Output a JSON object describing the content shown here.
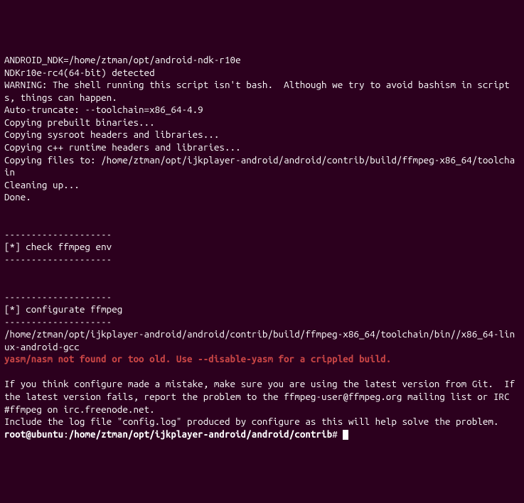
{
  "terminal": {
    "lines": [
      "ANDROID_NDK=/home/ztman/opt/android-ndk-r10e",
      "NDKr10e-rc4(64-bit) detected",
      "WARNING: The shell running this script isn't bash.  Although we try to avoid bashism in scripts, things can happen.",
      "Auto-truncate: --toolchain=x86_64-4.9",
      "Copying prebuilt binaries...",
      "Copying sysroot headers and libraries...",
      "Copying c++ runtime headers and libraries...",
      "Copying files to: /home/ztman/opt/ijkplayer-android/android/contrib/build/ffmpeg-x86_64/toolchain",
      "Cleaning up...",
      "Done.",
      "",
      "",
      "--------------------",
      "[*] check ffmpeg env",
      "--------------------",
      "",
      "",
      "--------------------",
      "[*] configurate ffmpeg",
      "--------------------",
      "/home/ztman/opt/ijkplayer-android/android/contrib/build/ffmpeg-x86_64/toolchain/bin//x86_64-linux-android-gcc"
    ],
    "error_line": "yasm/nasm not found or too old. Use --disable-yasm for a crippled build.",
    "post_error_lines": [
      "",
      "If you think configure made a mistake, make sure you are using the latest version from Git.  If the latest version fails, report the problem to the ffmpeg-user@ffmpeg.org mailing list or IRC #ffmpeg on irc.freenode.net.",
      "Include the log file \"config.log\" produced by configure as this will help solve the problem."
    ],
    "prompt": {
      "user_host": "root@ubuntu",
      "separator": ":",
      "path": "/home/ztman/opt/ijkplayer-android/android/contrib",
      "symbol": "#"
    }
  }
}
